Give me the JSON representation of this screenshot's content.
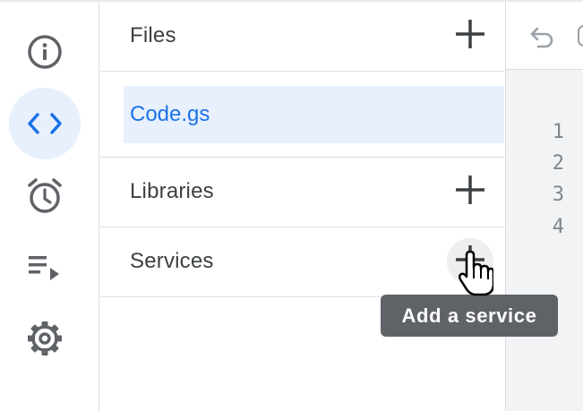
{
  "sidebar": {
    "items": [
      {
        "name": "overview",
        "icon": "info-icon"
      },
      {
        "name": "editor",
        "icon": "code-icon",
        "active": true
      },
      {
        "name": "triggers",
        "icon": "alarm-clock-icon"
      },
      {
        "name": "executions",
        "icon": "playlist-play-icon"
      },
      {
        "name": "settings",
        "icon": "gear-icon"
      }
    ]
  },
  "panel": {
    "files": {
      "label": "Files",
      "add_icon": "plus-icon"
    },
    "file_list": [
      {
        "name": "Code.gs",
        "selected": true
      }
    ],
    "libraries": {
      "label": "Libraries",
      "add_icon": "plus-icon"
    },
    "services": {
      "label": "Services",
      "add_icon": "plus-icon"
    }
  },
  "tooltip": {
    "text": "Add a service"
  },
  "editor": {
    "toolbar": {
      "undo_icon": "undo-icon"
    },
    "line_numbers": [
      "1",
      "2",
      "3",
      "4"
    ]
  },
  "colors": {
    "accent": "#1a73e8",
    "active_bg": "#e8f0fe",
    "icon": "#5f6368",
    "tooltip_bg": "#5f6368",
    "editor_bg": "#f1f3f4",
    "divider": "#dadce0"
  }
}
